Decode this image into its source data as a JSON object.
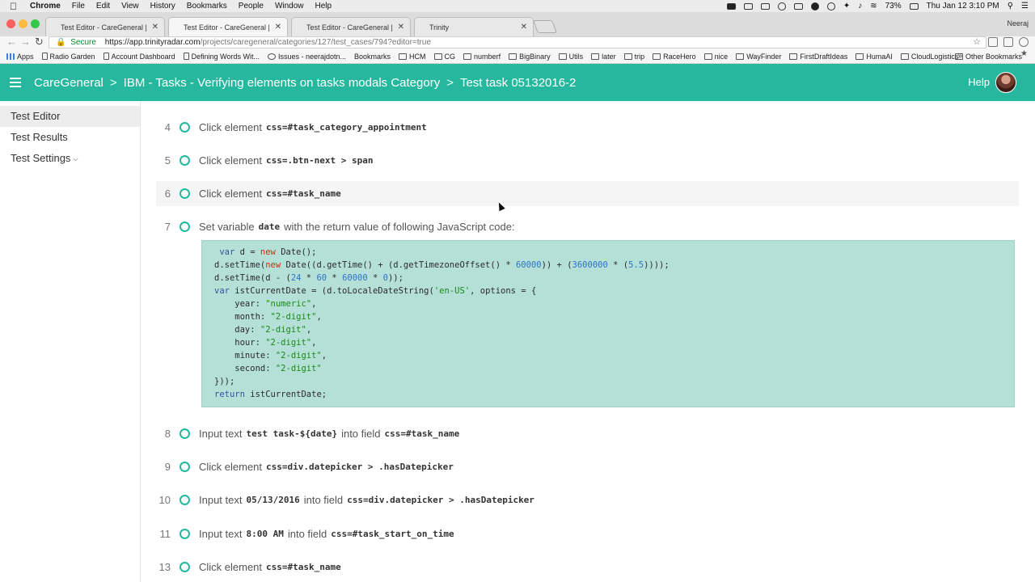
{
  "menubar": {
    "app": "Chrome",
    "items": [
      "File",
      "Edit",
      "View",
      "History",
      "Bookmarks",
      "People",
      "Window",
      "Help"
    ],
    "battery": "73%",
    "datetime": "Thu Jan 12  3:10 PM"
  },
  "tabs": [
    {
      "title": "Test Editor - CareGeneral | Tr"
    },
    {
      "title": "Test Editor - CareGeneral | Tr"
    },
    {
      "title": "Test Editor - CareGeneral | Tr"
    },
    {
      "title": "Trinity"
    }
  ],
  "profile_name": "Neeraj",
  "address": {
    "secure_label": "Secure",
    "host": "https://app.trinityradar.com",
    "path": "/projects/caregeneral/categories/127/test_cases/794?editor=true"
  },
  "bookmarks": {
    "apps": "Apps",
    "items": [
      "Radio Garden",
      "Account Dashboard",
      "Defining Words Wit...",
      "Issues - neerajdotn...",
      "Bookmarks",
      "HCM",
      "CG",
      "numberf",
      "BigBinary",
      "Utils",
      "later",
      "trip",
      "RaceHero",
      "nice",
      "WayFinder",
      "FirstDraftIdeas",
      "HumaAI",
      "CloudLogistics"
    ],
    "more": "»",
    "other": "Other Bookmarks"
  },
  "header": {
    "crumbs": [
      "CareGeneral",
      "IBM - Tasks - Verifying elements on tasks modals Category",
      "Test task 05132016-2"
    ],
    "separator": ">",
    "help": "Help"
  },
  "sidebar": {
    "items": [
      {
        "label": "Test Editor"
      },
      {
        "label": "Test Results"
      },
      {
        "label": "Test Settings"
      }
    ]
  },
  "steps": [
    {
      "num": "4",
      "action": "Click element",
      "value": "css=#task_category_appointment"
    },
    {
      "num": "5",
      "action": "Click element",
      "value": "css=.btn-next > span"
    },
    {
      "num": "6",
      "action": "Click element",
      "value": "css=#task_name"
    },
    {
      "num": "7",
      "action": "Set variable",
      "var": "date",
      "rest": "with the return value of following JavaScript code:"
    },
    {
      "num": "8",
      "action": "Input text",
      "value": "test task-${date}",
      "into": "into field",
      "field": "css=#task_name"
    },
    {
      "num": "9",
      "action": "Click element",
      "value": "css=div.datepicker > .hasDatepicker"
    },
    {
      "num": "10",
      "action": "Input text",
      "value": "05/13/2016",
      "into": "into field",
      "field": "css=div.datepicker > .hasDatepicker"
    },
    {
      "num": "11",
      "action": "Input text",
      "value": "8:00 AM",
      "into": "into field",
      "field": "css=#task_start_on_time"
    },
    {
      "num": "13",
      "action": "Click element",
      "value": "css=#task_name"
    }
  ],
  "code_lines": [
    " var d = new Date();",
    "d.setTime(new Date((d.getTime() + (d.getTimezoneOffset() * 60000)) + (3600000 * (5.5))));",
    "d.setTime(d - (24 * 60 * 60000 * 0));",
    "var istCurrentDate = (d.toLocaleDateString('en-US', options = {",
    "    year: \"numeric\",",
    "    month: \"2-digit\",",
    "    day: \"2-digit\",",
    "    hour: \"2-digit\",",
    "    minute: \"2-digit\",",
    "    second: \"2-digit\"",
    "}));",
    "return istCurrentDate;"
  ],
  "colors": {
    "brand": "#26b89e",
    "code_bg": "#b5e0d8"
  }
}
